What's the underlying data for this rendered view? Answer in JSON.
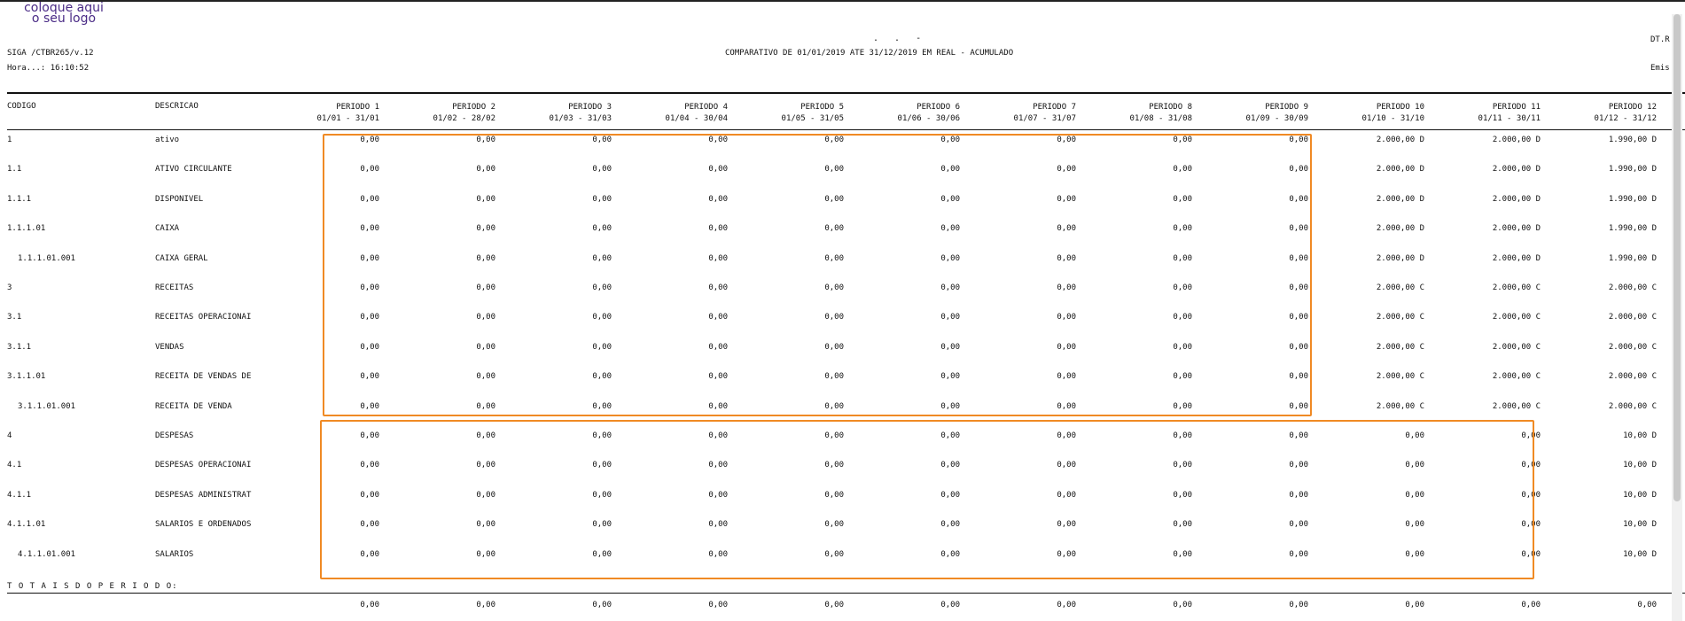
{
  "report": {
    "logo_line1": "coloque aqui",
    "logo_line2": "o seu logo",
    "dots": ". .  -",
    "program": "SIGA /CTBR265/v.12",
    "time": "Hora...: 16:10:52",
    "title": "COMPARATIVO DE 01/01/2019 ATE 31/12/2019 EM REAL - ACUMULADO",
    "right_top": "DT.R",
    "right_second": "Emis"
  },
  "table": {
    "col_codigo": "CODIGO",
    "col_descricao": "DESCRICAO",
    "periods": [
      {
        "name": "PERIODO 1",
        "range": "01/01 - 31/01"
      },
      {
        "name": "PERIODO 2",
        "range": "01/02 - 28/02"
      },
      {
        "name": "PERIODO 3",
        "range": "01/03 - 31/03"
      },
      {
        "name": "PERIODO 4",
        "range": "01/04 - 30/04"
      },
      {
        "name": "PERIODO 5",
        "range": "01/05 - 31/05"
      },
      {
        "name": "PERIODO 6",
        "range": "01/06 - 30/06"
      },
      {
        "name": "PERIODO 7",
        "range": "01/07 - 31/07"
      },
      {
        "name": "PERIODO 8",
        "range": "01/08 - 31/08"
      },
      {
        "name": "PERIODO 9",
        "range": "01/09 - 30/09"
      },
      {
        "name": "PERIODO 10",
        "range": "01/10 - 31/10"
      },
      {
        "name": "PERIODO 11",
        "range": "01/11 - 30/11"
      },
      {
        "name": "PERIODO 12",
        "range": "01/12 - 31/12"
      }
    ],
    "rows": [
      {
        "code": "1",
        "indent": false,
        "desc": "ativo",
        "values": [
          "0,00",
          "0,00",
          "0,00",
          "0,00",
          "0,00",
          "0,00",
          "0,00",
          "0,00",
          "0,00",
          "2.000,00 D",
          "2.000,00 D",
          "1.990,00 D"
        ]
      },
      {
        "code": "1.1",
        "indent": false,
        "desc": "ATIVO CIRCULANTE",
        "values": [
          "0,00",
          "0,00",
          "0,00",
          "0,00",
          "0,00",
          "0,00",
          "0,00",
          "0,00",
          "0,00",
          "2.000,00 D",
          "2.000,00 D",
          "1.990,00 D"
        ]
      },
      {
        "code": "1.1.1",
        "indent": false,
        "desc": "DISPONIVEL",
        "values": [
          "0,00",
          "0,00",
          "0,00",
          "0,00",
          "0,00",
          "0,00",
          "0,00",
          "0,00",
          "0,00",
          "2.000,00 D",
          "2.000,00 D",
          "1.990,00 D"
        ]
      },
      {
        "code": "1.1.1.01",
        "indent": false,
        "desc": "CAIXA",
        "values": [
          "0,00",
          "0,00",
          "0,00",
          "0,00",
          "0,00",
          "0,00",
          "0,00",
          "0,00",
          "0,00",
          "2.000,00 D",
          "2.000,00 D",
          "1.990,00 D"
        ]
      },
      {
        "code": "1.1.1.01.001",
        "indent": true,
        "desc": "CAIXA GERAL",
        "values": [
          "0,00",
          "0,00",
          "0,00",
          "0,00",
          "0,00",
          "0,00",
          "0,00",
          "0,00",
          "0,00",
          "2.000,00 D",
          "2.000,00 D",
          "1.990,00 D"
        ]
      },
      {
        "code": "3",
        "indent": false,
        "desc": "RECEITAS",
        "values": [
          "0,00",
          "0,00",
          "0,00",
          "0,00",
          "0,00",
          "0,00",
          "0,00",
          "0,00",
          "0,00",
          "2.000,00 C",
          "2.000,00 C",
          "2.000,00 C"
        ]
      },
      {
        "code": "3.1",
        "indent": false,
        "desc": "RECEITAS OPERACIONAI",
        "values": [
          "0,00",
          "0,00",
          "0,00",
          "0,00",
          "0,00",
          "0,00",
          "0,00",
          "0,00",
          "0,00",
          "2.000,00 C",
          "2.000,00 C",
          "2.000,00 C"
        ]
      },
      {
        "code": "3.1.1",
        "indent": false,
        "desc": "VENDAS",
        "values": [
          "0,00",
          "0,00",
          "0,00",
          "0,00",
          "0,00",
          "0,00",
          "0,00",
          "0,00",
          "0,00",
          "2.000,00 C",
          "2.000,00 C",
          "2.000,00 C"
        ]
      },
      {
        "code": "3.1.1.01",
        "indent": false,
        "desc": "RECEITA DE VENDAS DE",
        "values": [
          "0,00",
          "0,00",
          "0,00",
          "0,00",
          "0,00",
          "0,00",
          "0,00",
          "0,00",
          "0,00",
          "2.000,00 C",
          "2.000,00 C",
          "2.000,00 C"
        ]
      },
      {
        "code": "3.1.1.01.001",
        "indent": true,
        "desc": "RECEITA DE VENDA",
        "values": [
          "0,00",
          "0,00",
          "0,00",
          "0,00",
          "0,00",
          "0,00",
          "0,00",
          "0,00",
          "0,00",
          "2.000,00 C",
          "2.000,00 C",
          "2.000,00 C"
        ]
      },
      {
        "code": "4",
        "indent": false,
        "desc": "DESPESAS",
        "values": [
          "0,00",
          "0,00",
          "0,00",
          "0,00",
          "0,00",
          "0,00",
          "0,00",
          "0,00",
          "0,00",
          "0,00",
          "0,00",
          "10,00 D"
        ]
      },
      {
        "code": "4.1",
        "indent": false,
        "desc": "DESPESAS OPERACIONAI",
        "values": [
          "0,00",
          "0,00",
          "0,00",
          "0,00",
          "0,00",
          "0,00",
          "0,00",
          "0,00",
          "0,00",
          "0,00",
          "0,00",
          "10,00 D"
        ]
      },
      {
        "code": "4.1.1",
        "indent": false,
        "desc": "DESPESAS ADMINISTRAT",
        "values": [
          "0,00",
          "0,00",
          "0,00",
          "0,00",
          "0,00",
          "0,00",
          "0,00",
          "0,00",
          "0,00",
          "0,00",
          "0,00",
          "10,00 D"
        ]
      },
      {
        "code": "4.1.1.01",
        "indent": false,
        "desc": "SALARIOS E ORDENADOS",
        "values": [
          "0,00",
          "0,00",
          "0,00",
          "0,00",
          "0,00",
          "0,00",
          "0,00",
          "0,00",
          "0,00",
          "0,00",
          "0,00",
          "10,00 D"
        ]
      },
      {
        "code": "4.1.1.01.001",
        "indent": true,
        "desc": "SALARIOS",
        "values": [
          "0,00",
          "0,00",
          "0,00",
          "0,00",
          "0,00",
          "0,00",
          "0,00",
          "0,00",
          "0,00",
          "0,00",
          "0,00",
          "10,00 D"
        ]
      }
    ],
    "totals_label": "T O T A I S  D O  P E R I O D O:",
    "totals": [
      "0,00",
      "0,00",
      "0,00",
      "0,00",
      "0,00",
      "0,00",
      "0,00",
      "0,00",
      "0,00",
      "0,00",
      "0,00",
      "0,00"
    ]
  },
  "colors": {
    "highlight": "#f08a24",
    "logo": "#4a2b86"
  }
}
